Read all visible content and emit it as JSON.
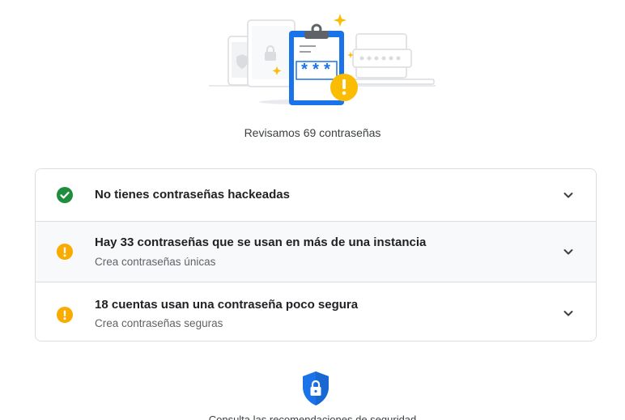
{
  "summary": {
    "text": "Revisamos 69 contraseñas"
  },
  "checks": [
    {
      "title": "No tienes contraseñas hackeadas",
      "subtitle": "",
      "status": "ok",
      "status_color": "#1e8e3e",
      "icon": "check-circle-icon"
    },
    {
      "title": "Hay 33 contraseñas que se usan en más de una instancia",
      "subtitle": "Crea contraseñas únicas",
      "status": "warning",
      "status_color": "#f9ab00",
      "icon": "warning-circle-icon"
    },
    {
      "title": "18 cuentas usan una contraseña poco segura",
      "subtitle": "Crea contraseñas seguras",
      "status": "warning",
      "status_color": "#f9ab00",
      "icon": "warning-circle-icon"
    }
  ],
  "illustration": {
    "password_mask": "***",
    "icon": "clipboard-password-illustration"
  },
  "footer": {
    "link_text": "Consulta las recomendaciones de seguridad",
    "icon": "security-shield-icon"
  },
  "colors": {
    "accent_blue": "#1a73e8",
    "warning_yellow": "#f9ab00",
    "success_green": "#1e8e3e"
  }
}
